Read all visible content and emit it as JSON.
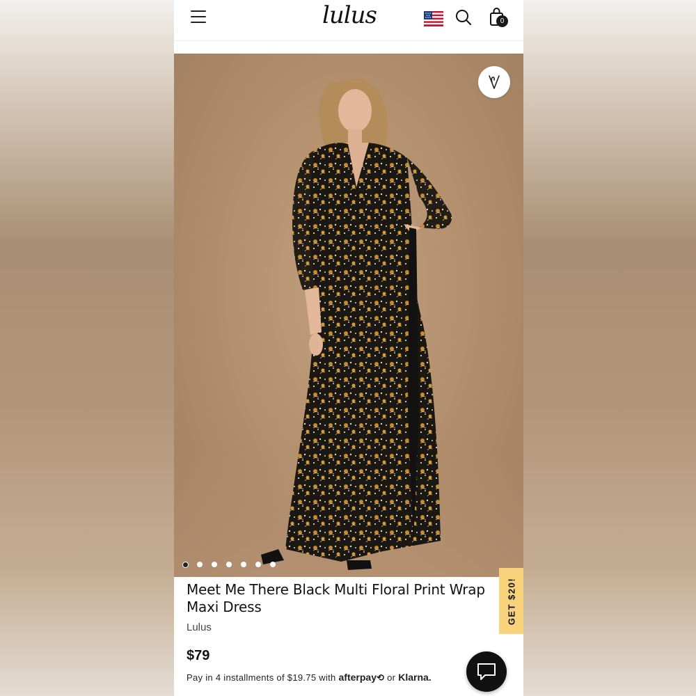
{
  "header": {
    "menu_icon": "hamburger-menu-icon",
    "logo_text": "lulus",
    "flag_icon": "us-flag-icon",
    "search_icon": "search-icon",
    "bag_icon": "shopping-bag-icon",
    "bag_count": "0"
  },
  "gallery": {
    "favorite_icon": "heart-icon",
    "dot_count": 7,
    "active_dot_index": 0
  },
  "product": {
    "title": "Meet Me There Black Multi Floral Print Wrap Maxi Dress",
    "brand": "Lulus",
    "price": "$79",
    "installments_prefix": "Pay in 4 installments of $19.75 with",
    "afterpay_label": "afterpay",
    "installments_or": "or",
    "klarna_label": "Klarna."
  },
  "promo": {
    "label": "GET $20!"
  },
  "chat": {
    "icon": "chat-bubble-icon"
  },
  "colors": {
    "accent": "#f9d37c",
    "background_tan": "#b08d6b",
    "text": "#111111"
  }
}
